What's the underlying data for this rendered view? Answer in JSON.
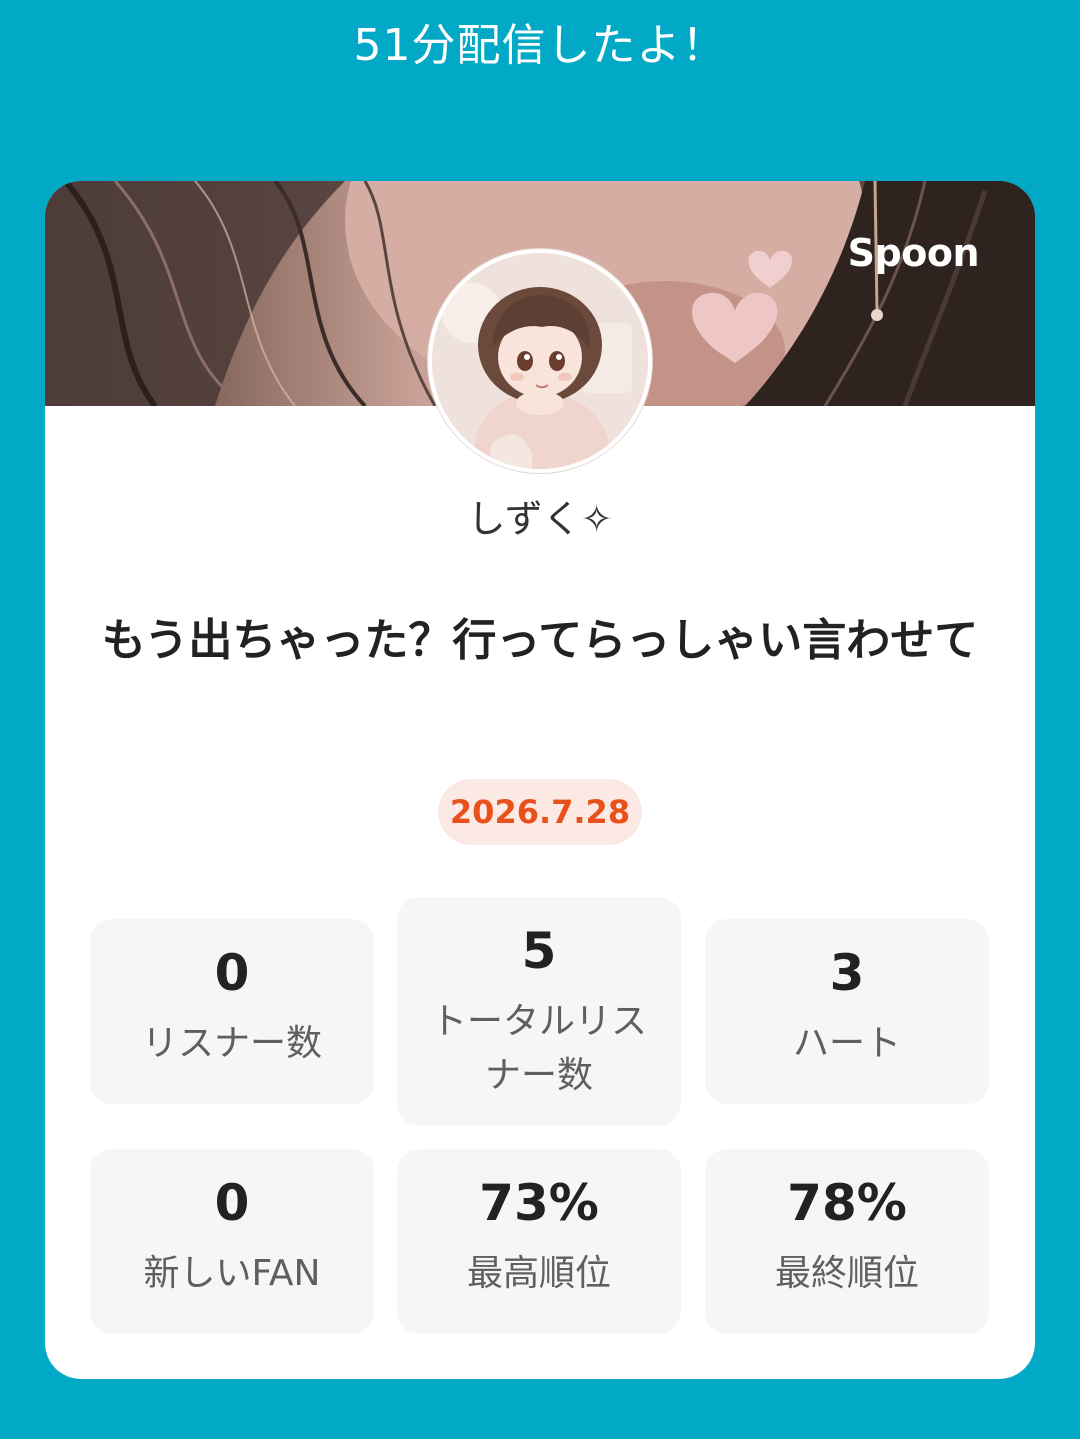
{
  "header": {
    "summary": "51分配信したよ！"
  },
  "card": {
    "brand": "Spoon",
    "username": "しずく✧",
    "title": "もう出ちゃった？行ってらっしゃい言わせて",
    "date": "2026.7.28",
    "stats": [
      {
        "value": "0",
        "label": "リスナー数"
      },
      {
        "value": "5",
        "label": "トータルリスナー数"
      },
      {
        "value": "3",
        "label": "ハート"
      },
      {
        "value": "0",
        "label": "新しいFAN"
      },
      {
        "value": "73%",
        "label": "最高順位"
      },
      {
        "value": "78%",
        "label": "最終順位"
      }
    ]
  },
  "colors": {
    "background": "#02a9c6",
    "card": "#ffffff",
    "date_text": "#e8501c",
    "date_bg": "#fde9e3",
    "stat_bg": "#f6f6f6"
  },
  "images": {
    "banner": "cover-photo-hair-and-hearts",
    "avatar": "illustrated-girl-avatar"
  }
}
